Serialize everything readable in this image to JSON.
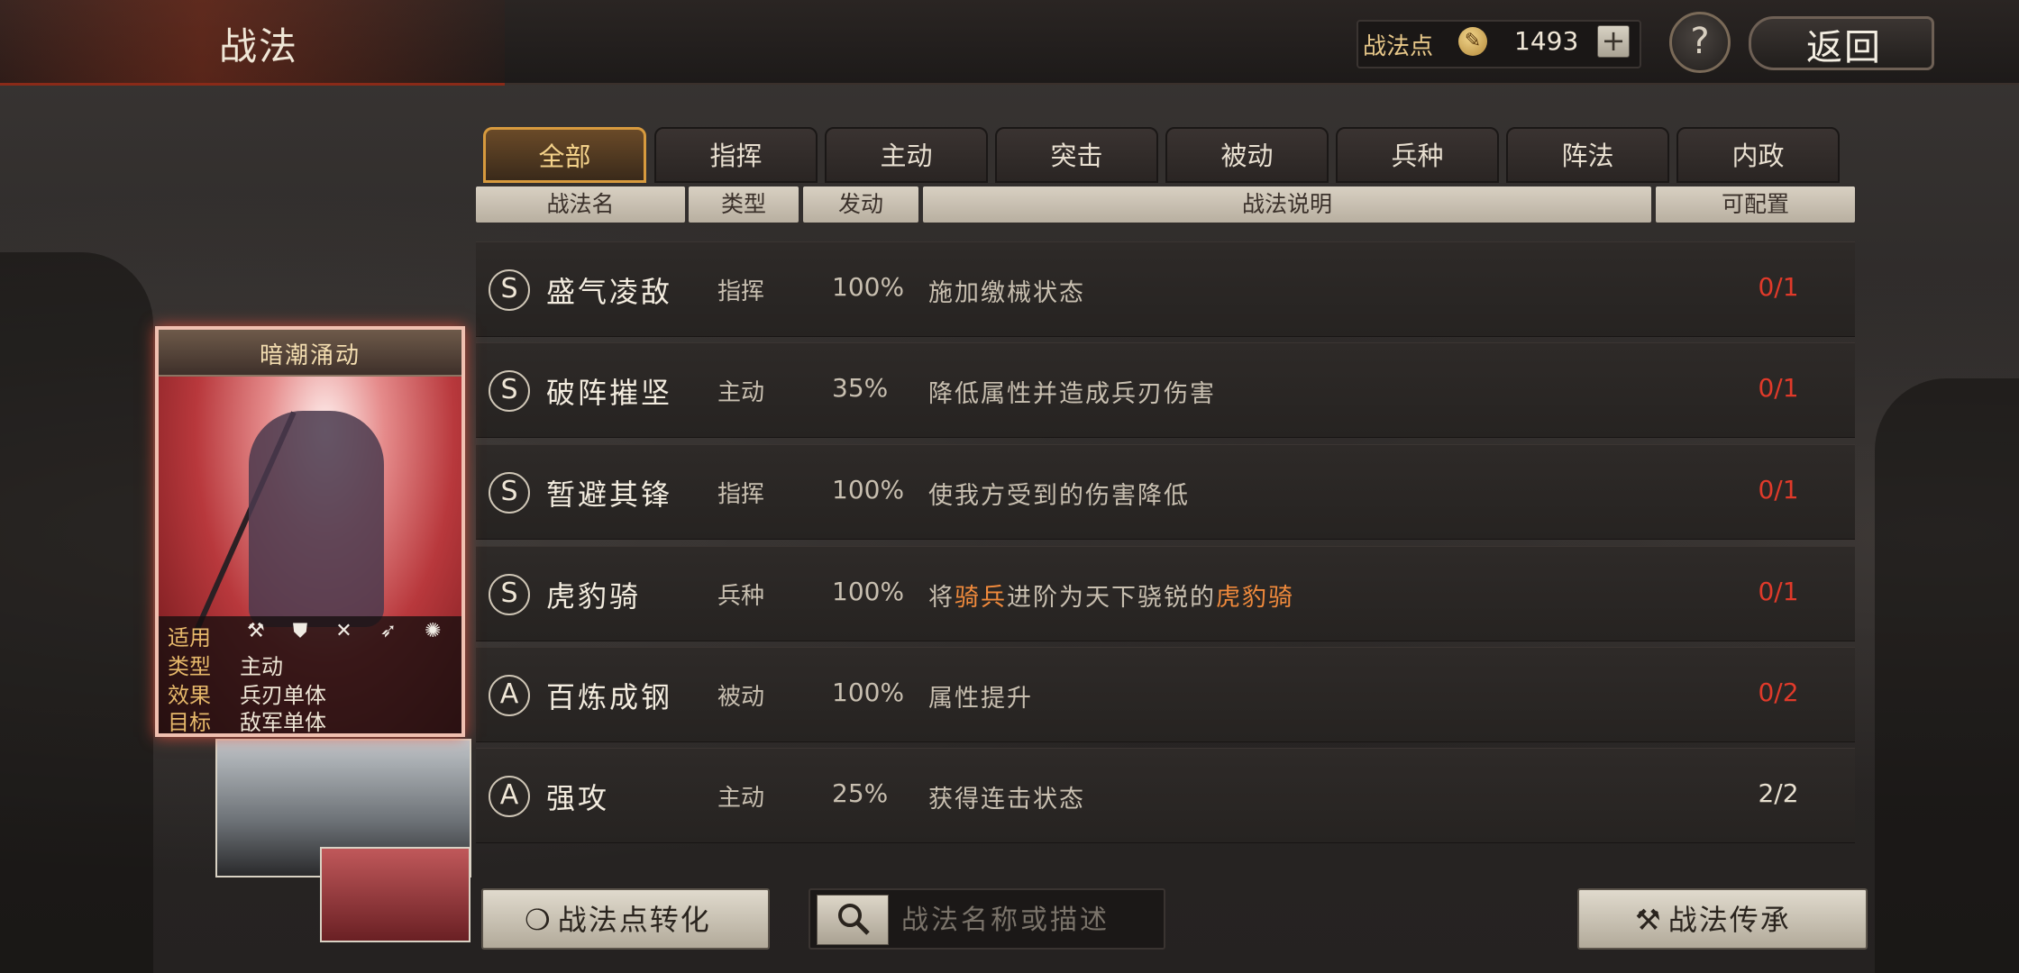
{
  "header": {
    "title": "战法",
    "points_label": "战法点",
    "points_value": "1493",
    "plus_label": "+",
    "help_label": "?",
    "back_label": "返回"
  },
  "tabs": [
    {
      "label": "全部",
      "active": true
    },
    {
      "label": "指挥",
      "active": false
    },
    {
      "label": "主动",
      "active": false
    },
    {
      "label": "突击",
      "active": false
    },
    {
      "label": "被动",
      "active": false
    },
    {
      "label": "兵种",
      "active": false
    },
    {
      "label": "阵法",
      "active": false
    },
    {
      "label": "内政",
      "active": false
    }
  ],
  "columns": [
    "战法名",
    "类型",
    "发动",
    "战法说明",
    "可配置"
  ],
  "skills": [
    {
      "grade": "S",
      "name": "盛气凌敌",
      "type": "指挥",
      "rate": "100%",
      "desc_parts": [
        [
          "施加缴械状态",
          false
        ]
      ],
      "count": "0/1",
      "full": false
    },
    {
      "grade": "S",
      "name": "破阵摧坚",
      "type": "主动",
      "rate": "35%",
      "desc_parts": [
        [
          "降低属性并造成兵刃伤害",
          false
        ]
      ],
      "count": "0/1",
      "full": false
    },
    {
      "grade": "S",
      "name": "暂避其锋",
      "type": "指挥",
      "rate": "100%",
      "desc_parts": [
        [
          "使我方受到的伤害降低",
          false
        ]
      ],
      "count": "0/1",
      "full": false
    },
    {
      "grade": "S",
      "name": "虎豹骑",
      "type": "兵种",
      "rate": "100%",
      "desc_parts": [
        [
          "将",
          false
        ],
        [
          "骑兵",
          true
        ],
        [
          "进阶为天下骁锐的",
          false
        ],
        [
          "虎豹骑",
          true
        ]
      ],
      "count": "0/1",
      "full": false
    },
    {
      "grade": "A",
      "name": "百炼成钢",
      "type": "被动",
      "rate": "100%",
      "desc_parts": [
        [
          "属性提升",
          false
        ]
      ],
      "count": "0/2",
      "full": false
    },
    {
      "grade": "A",
      "name": "强攻",
      "type": "主动",
      "rate": "25%",
      "desc_parts": [
        [
          "获得连击状态",
          false
        ]
      ],
      "count": "2/2",
      "full": true
    }
  ],
  "card": {
    "title": "暗潮涌动",
    "applies_label": "适用",
    "applies_icons": "⚒ ⛊ ✕ ➶ ✺",
    "type_label": "类型",
    "type_value": "主动",
    "effect_label": "效果",
    "effect_value": "兵刃单体",
    "target_label": "目标",
    "target_value": "敌军单体"
  },
  "bottom": {
    "convert_label": "战法点转化",
    "search_placeholder": "战法名称或描述",
    "inherit_label": "战法传承"
  },
  "colors": {
    "accent_orange": "#f08a3c",
    "count_red": "#e03a2a",
    "tab_active_border": "#d79a3e"
  }
}
